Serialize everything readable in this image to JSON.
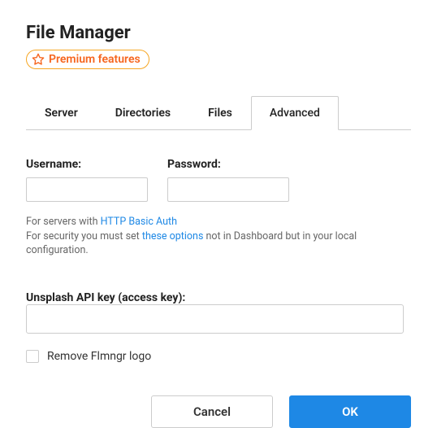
{
  "header": {
    "title": "File Manager",
    "premium_label": "Premium features"
  },
  "tabs": [
    {
      "label": "Server",
      "active": false
    },
    {
      "label": "Directories",
      "active": false
    },
    {
      "label": "Files",
      "active": false
    },
    {
      "label": "Advanced",
      "active": true
    }
  ],
  "form": {
    "username_label": "Username:",
    "username_value": "",
    "password_label": "Password:",
    "password_value": "",
    "help_line1_prefix": "For servers with ",
    "help_line1_link": "HTTP Basic Auth",
    "help_line2_prefix": "For security you must set ",
    "help_line2_link": "these options",
    "help_line2_suffix": " not in Dashboard but in your local configuration.",
    "api_key_label": "Unsplash API key (access key):",
    "api_key_value": "",
    "remove_logo_label": "Remove Flmngr logo",
    "remove_logo_checked": false
  },
  "buttons": {
    "cancel": "Cancel",
    "ok": "OK"
  }
}
